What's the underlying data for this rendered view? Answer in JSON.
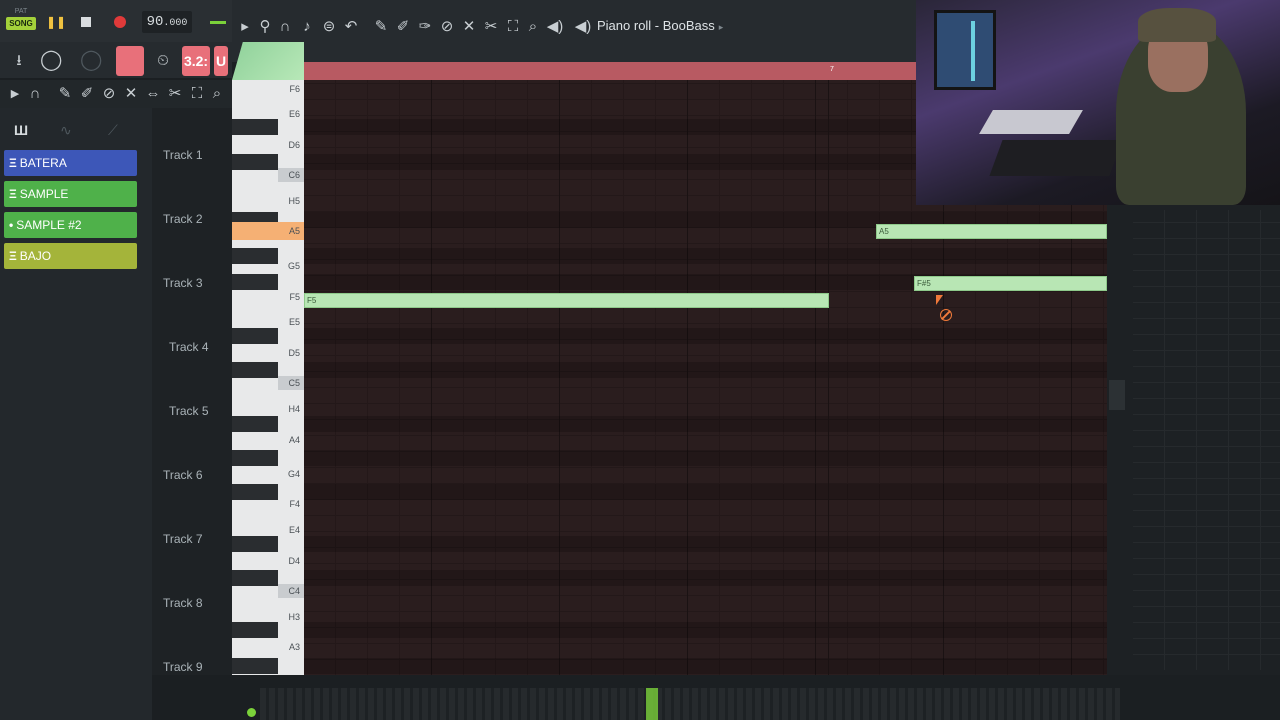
{
  "transport": {
    "pat_label": "PAT",
    "song_label": "SONG",
    "tempo_main": "90",
    "tempo_fraction": ".000",
    "pink_button_1": "",
    "pink_button_2": "3.2:",
    "pink_button_3": "U"
  },
  "piano_roll": {
    "title": "Piano roll - BooBass",
    "ruler_mark": "7"
  },
  "channels": [
    {
      "prefix": "Ξ",
      "label": "BATERA",
      "color": "#3d57b8"
    },
    {
      "prefix": "Ξ",
      "label": "SAMPLE",
      "color": "#4fb14a"
    },
    {
      "prefix": "•",
      "label": "SAMPLE #2",
      "color": "#4fb14a"
    },
    {
      "prefix": "Ξ",
      "label": "BAJO",
      "color": "#a4b43a"
    }
  ],
  "tracks": [
    "Track 1",
    "Track 2",
    "Track 3",
    "Track 4",
    "Track 5",
    "Track 6",
    "Track 7",
    "Track 8",
    "Track 9"
  ],
  "keys": [
    "F6",
    "E6",
    "D6",
    "C6",
    "H5",
    "A5",
    "G5",
    "F5",
    "E5",
    "D5",
    "C5",
    "H4",
    "A4",
    "G4",
    "F4",
    "E4",
    "D4",
    "C4",
    "H3",
    "A3"
  ],
  "notes": [
    {
      "label": "A5"
    },
    {
      "label": "F#5"
    },
    {
      "label": "F5"
    }
  ],
  "toolbar_icons": [
    "playlist-icon",
    "magnet-icon",
    "note-icon",
    "stamp-icon",
    "undo-icon",
    "pencil-icon",
    "paint-icon",
    "delete-icon",
    "mute-icon",
    "slice-icon",
    "select-icon",
    "zoom-icon",
    "speaker-icon"
  ],
  "colors": {
    "accent_green": "#7bd13a",
    "note_green": "#b8e6b4",
    "ruler": "#b85a62",
    "highlight_key": "#f5b074"
  }
}
